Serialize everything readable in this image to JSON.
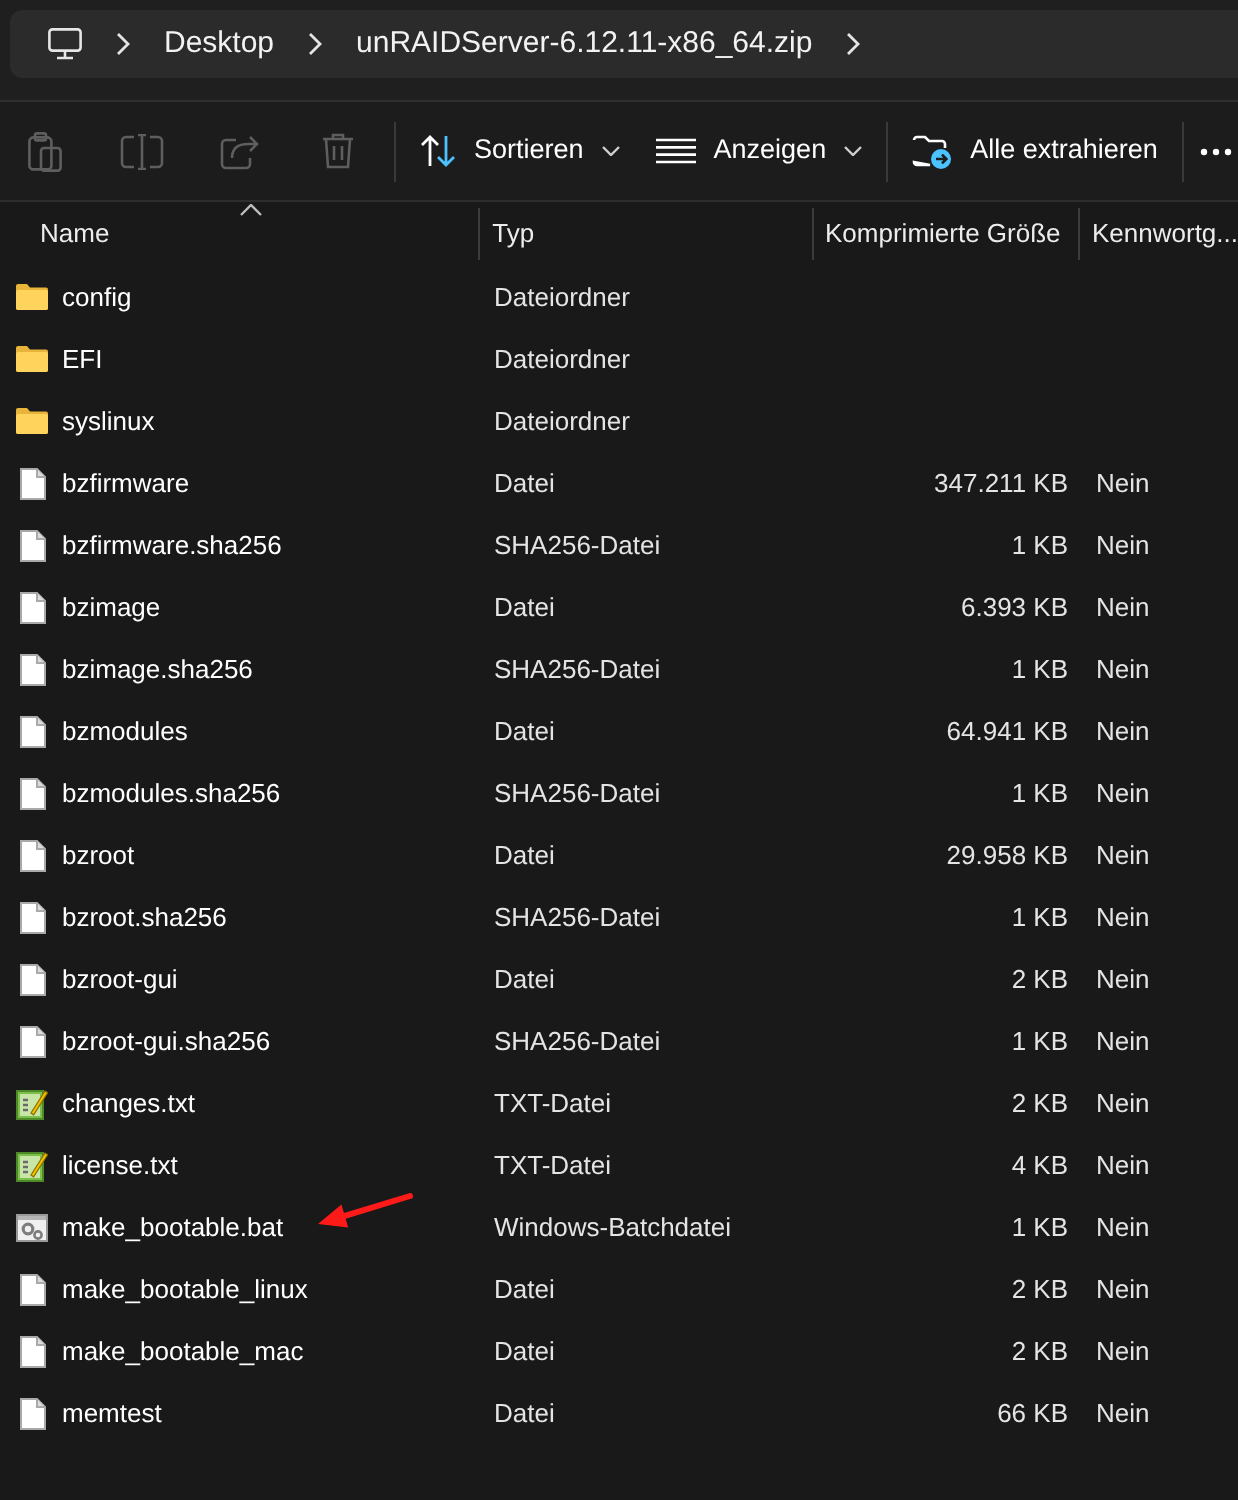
{
  "breadcrumb": [
    "Desktop",
    "unRAIDServer-6.12.11-x86_64.zip"
  ],
  "toolbar": [
    [
      {
        "kind": "paste",
        "disabled": true
      },
      {
        "kind": "rename",
        "disabled": true
      },
      {
        "kind": "share",
        "disabled": true
      },
      {
        "kind": "delete",
        "disabled": true
      }
    ],
    [
      {
        "kind": "sort",
        "label": "Sortieren",
        "dropdown": true
      },
      {
        "kind": "view",
        "label": "Anzeigen",
        "dropdown": true
      }
    ],
    [
      {
        "kind": "extract",
        "label": "Alle extrahieren",
        "dropdown": false
      }
    ],
    [
      {
        "kind": "more"
      }
    ]
  ],
  "columns": [
    {
      "label": "Name",
      "sorted": true
    },
    {
      "label": "Typ",
      "sorted": false
    },
    {
      "label": "Komprimierte Größe",
      "sorted": false
    },
    {
      "label": "Kennwortg...",
      "sorted": false
    }
  ],
  "rows": [
    {
      "kind": "folder",
      "name": "config",
      "type": "Dateiordner"
    },
    {
      "kind": "folder",
      "name": "EFI",
      "type": "Dateiordner"
    },
    {
      "kind": "folder",
      "name": "syslinux",
      "type": "Dateiordner"
    },
    {
      "kind": "file",
      "name": "bzfirmware",
      "type": "Datei",
      "size": "347.211 KB",
      "password": "Nein"
    },
    {
      "kind": "file",
      "name": "bzfirmware.sha256",
      "type": "SHA256-Datei",
      "size": "1 KB",
      "password": "Nein"
    },
    {
      "kind": "file",
      "name": "bzimage",
      "type": "Datei",
      "size": "6.393 KB",
      "password": "Nein"
    },
    {
      "kind": "file",
      "name": "bzimage.sha256",
      "type": "SHA256-Datei",
      "size": "1 KB",
      "password": "Nein"
    },
    {
      "kind": "file",
      "name": "bzmodules",
      "type": "Datei",
      "size": "64.941 KB",
      "password": "Nein"
    },
    {
      "kind": "file",
      "name": "bzmodules.sha256",
      "type": "SHA256-Datei",
      "size": "1 KB",
      "password": "Nein"
    },
    {
      "kind": "file",
      "name": "bzroot",
      "type": "Datei",
      "size": "29.958 KB",
      "password": "Nein"
    },
    {
      "kind": "file",
      "name": "bzroot.sha256",
      "type": "SHA256-Datei",
      "size": "1 KB",
      "password": "Nein"
    },
    {
      "kind": "file",
      "name": "bzroot-gui",
      "type": "Datei",
      "size": "2 KB",
      "password": "Nein"
    },
    {
      "kind": "file",
      "name": "bzroot-gui.sha256",
      "type": "SHA256-Datei",
      "size": "1 KB",
      "password": "Nein"
    },
    {
      "kind": "text",
      "name": "changes.txt",
      "type": "TXT-Datei",
      "size": "2 KB",
      "password": "Nein"
    },
    {
      "kind": "text",
      "name": "license.txt",
      "type": "TXT-Datei",
      "size": "4 KB",
      "password": "Nein"
    },
    {
      "kind": "batch",
      "name": "make_bootable.bat",
      "type": "Windows-Batchdatei",
      "size": "1 KB",
      "password": "Nein"
    },
    {
      "kind": "file",
      "name": "make_bootable_linux",
      "type": "Datei",
      "size": "2 KB",
      "password": "Nein"
    },
    {
      "kind": "file",
      "name": "make_bootable_mac",
      "type": "Datei",
      "size": "2 KB",
      "password": "Nein"
    },
    {
      "kind": "file",
      "name": "memtest",
      "type": "Datei",
      "size": "66 KB",
      "password": "Nein"
    }
  ]
}
